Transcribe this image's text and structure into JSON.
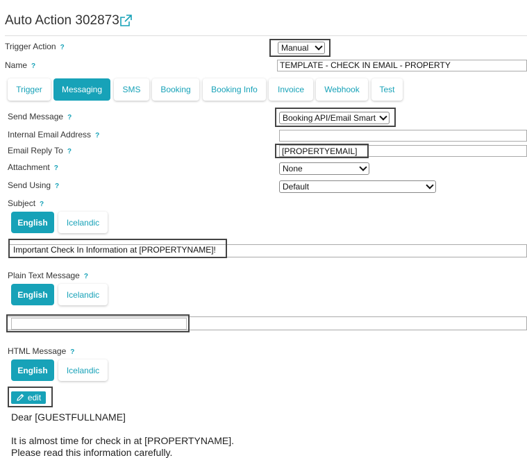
{
  "page": {
    "title": "Auto Action 302873",
    "external_icon": "external-link-icon"
  },
  "form": {
    "help_mark": "?",
    "trigger_action": {
      "label": "Trigger Action",
      "value": "Manual"
    },
    "name": {
      "label": "Name",
      "value": "TEMPLATE - CHECK IN EMAIL - PROPERTY"
    }
  },
  "tabs": [
    {
      "label": "Trigger"
    },
    {
      "label": "Messaging",
      "active": true
    },
    {
      "label": "SMS"
    },
    {
      "label": "Booking"
    },
    {
      "label": "Booking Info"
    },
    {
      "label": "Invoice"
    },
    {
      "label": "Webhook"
    },
    {
      "label": "Test"
    }
  ],
  "messaging": {
    "send_message": {
      "label": "Send Message",
      "value": "Booking API/Email Smart"
    },
    "internal_email": {
      "label": "Internal Email Address",
      "value": ""
    },
    "email_reply_to": {
      "label": "Email Reply To",
      "value": "[PROPERTYEMAIL]"
    },
    "attachment": {
      "label": "Attachment",
      "value": "None"
    },
    "send_using": {
      "label": "Send Using",
      "value": "Default"
    },
    "subject": {
      "label": "Subject",
      "lang_english": "English",
      "lang_icelandic": "Icelandic",
      "value": "Important Check In Information at [PROPERTYNAME]!"
    },
    "plain_text": {
      "label": "Plain Text Message",
      "lang_english": "English",
      "lang_icelandic": "Icelandic",
      "value": ""
    },
    "html_message": {
      "label": "HTML Message",
      "lang_english": "English",
      "lang_icelandic": "Icelandic",
      "edit_label": "edit",
      "edit_icon": "pencil-icon",
      "line1": "Dear [GUESTFULLNAME]",
      "line2": "It is almost time for check in at [PROPERTYNAME].",
      "line3": "Please read this information carefully."
    }
  },
  "colors": {
    "accent": "#17a2b8"
  }
}
